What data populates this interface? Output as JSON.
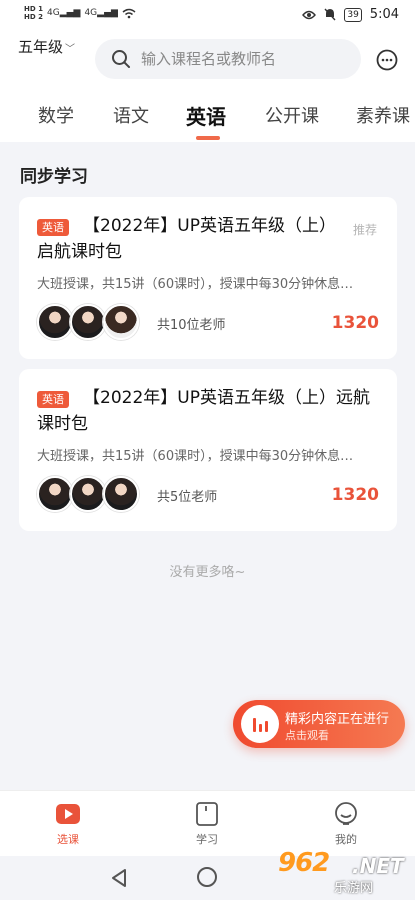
{
  "status_bar": {
    "left_top": "HD 1",
    "left_bottom": "HD 2",
    "signal1": "4G",
    "signal2": "4G",
    "battery": "39",
    "time": "5:04"
  },
  "header": {
    "grade": "五年级",
    "search_placeholder": "输入课程名或教师名",
    "tabs": [
      {
        "label": "数学"
      },
      {
        "label": "语文"
      },
      {
        "label": "英语"
      },
      {
        "label": "公开课"
      },
      {
        "label": "素养课"
      }
    ],
    "active_tab": "英语"
  },
  "section": {
    "title": "同步学习"
  },
  "courses": [
    {
      "tag": "英语",
      "title": "【2022年】UP英语五年级（上）启航课时包",
      "badge": "推荐",
      "description": "大班授课，共15讲（60课时），授课中每30分钟休息…",
      "teachers": "共10位老师",
      "price": "1320"
    },
    {
      "tag": "英语",
      "title": "【2022年】UP英语五年级（上）远航课时包",
      "description": "大班授课，共15讲（60课时），授课中每30分钟休息…",
      "teachers": "共5位老师",
      "price": "1320"
    }
  ],
  "no_more": "没有更多咯~",
  "live_banner": {
    "title": "精彩内容正在进行",
    "subtitle": "点击观看"
  },
  "bottom_nav": [
    {
      "label": "选课",
      "icon": "play-icon"
    },
    {
      "label": "学习",
      "icon": "book-icon"
    },
    {
      "label": "我的",
      "icon": "profile-icon"
    }
  ],
  "watermark": {
    "number": "962",
    "net": ".NET",
    "text": "乐游网"
  },
  "colors": {
    "accent": "#e9533a",
    "tab_underline": "#f06a4a",
    "background": "#f3f4f8"
  }
}
